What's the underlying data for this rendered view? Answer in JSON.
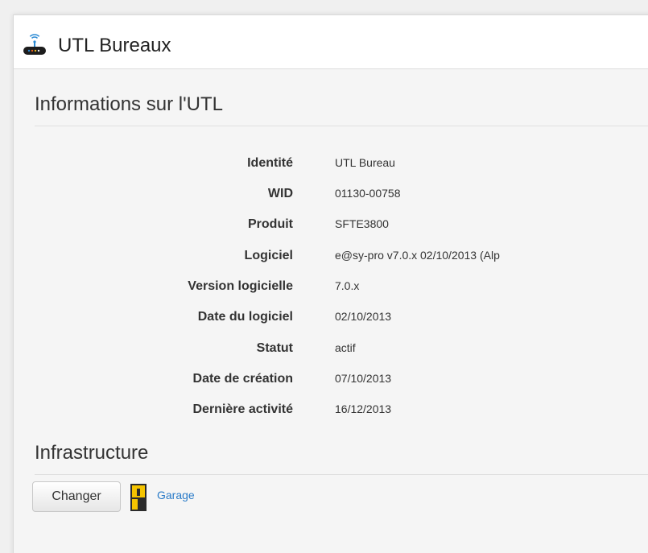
{
  "header": {
    "title": "UTL Bureaux",
    "icon": "router-device-icon"
  },
  "info_section": {
    "title": "Informations sur l'UTL",
    "rows": [
      {
        "label": "Identité",
        "value": "UTL Bureau"
      },
      {
        "label": "WID",
        "value": "01130-00758"
      },
      {
        "label": "Produit",
        "value": "SFTE3800"
      },
      {
        "label": "Logiciel",
        "value": "e@sy-pro v7.0.x 02/10/2013 (Alp"
      },
      {
        "label": "Version logicielle",
        "value": "7.0.x"
      },
      {
        "label": "Date du logiciel",
        "value": "02/10/2013"
      },
      {
        "label": "Statut",
        "value": "actif"
      },
      {
        "label": "Date de création",
        "value": "07/10/2013"
      },
      {
        "label": "Dernière activité",
        "value": "16/12/2013"
      }
    ]
  },
  "infrastructure_section": {
    "title": "Infrastructure",
    "change_button_label": "Changer",
    "location_icon": "door-icon",
    "location_link": "Garage"
  },
  "colors": {
    "link": "#2a7bc8",
    "door_yellow": "#f5c400",
    "door_dark": "#2b2b2b",
    "wifi_blue": "#2a8ad4"
  }
}
